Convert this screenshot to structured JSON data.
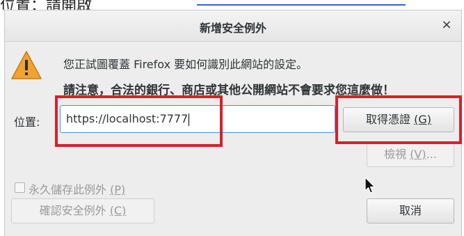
{
  "background_fragment": "位置：請開啟",
  "dialog": {
    "title": "新增安全例外",
    "close_glyph": "×",
    "message_line1": "您正試圖覆蓋 Firefox 要如何識別此網站的設定。",
    "message_line2": "請注意，合法的銀行、商店或其他公開網站不會要求您這麼做！",
    "location_label": "位置:",
    "location_value": "https://localhost:7777",
    "get_certificate_button": {
      "text": "取得憑證 ",
      "mnemonic": "(G)"
    },
    "view_button": {
      "text": "檢視 ",
      "mnemonic": "(V)",
      "suffix": "..."
    },
    "permanent_checkbox": {
      "text": "永久儲存此例外 ",
      "mnemonic": "(P)",
      "checked": false
    },
    "confirm_button": {
      "text": "確認安全例外 ",
      "mnemonic": "(C)"
    },
    "cancel_button": "取消"
  },
  "colors": {
    "highlight": "#d8202a",
    "warning": "#f0a32f",
    "dialog_bg": "#ededed",
    "disabled_text": "#9a9a9a"
  }
}
